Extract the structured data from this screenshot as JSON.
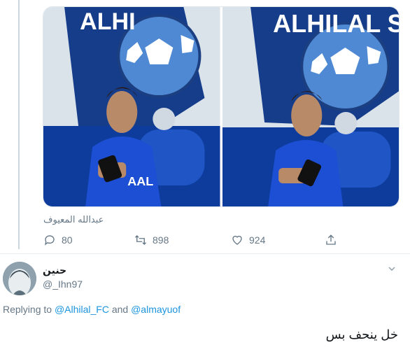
{
  "tweet": {
    "photo_tag": "عبدالله المعيوف",
    "actions": {
      "replies": "80",
      "retweets": "898",
      "likes": "924"
    },
    "icons": [
      "reply-icon",
      "retweet-icon",
      "like-icon",
      "share-icon"
    ]
  },
  "reply": {
    "display_name": "حنين",
    "handle": "@_Ihn97",
    "replying_prefix": "Replying to",
    "mention_1": "@Alhilal_FC",
    "and_text": "and",
    "mention_2": "@almayuof",
    "text": "خل ينحف بس"
  },
  "colors": {
    "link": "#1b95e0",
    "secondary_text": "#657786",
    "background": "#ffffff"
  }
}
